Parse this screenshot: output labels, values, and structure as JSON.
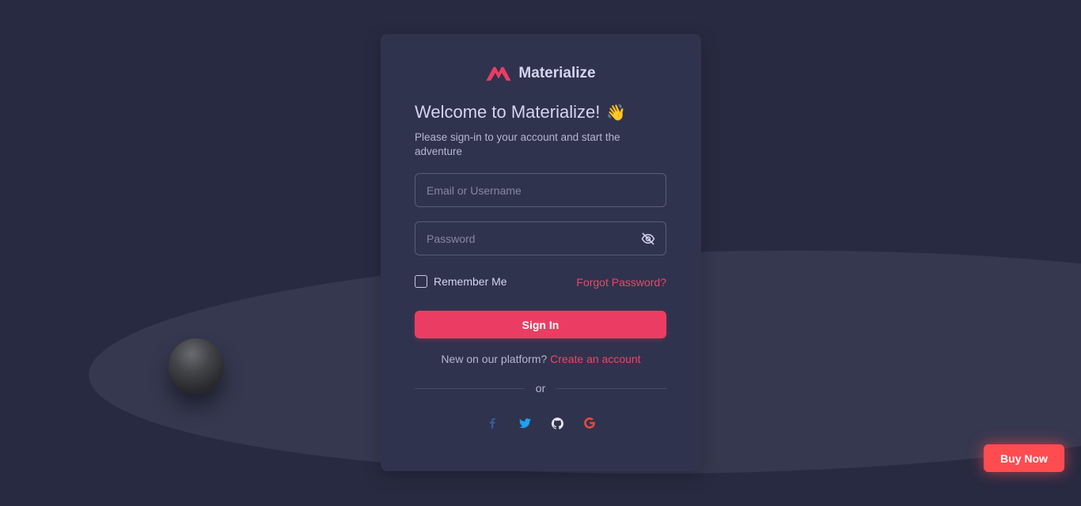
{
  "brand": {
    "name": "Materialize",
    "logo_icon": "materialize-logo-icon",
    "accent_color": "#eb3d63"
  },
  "login": {
    "heading": "Welcome to Materialize!",
    "heading_emoji": "👋",
    "subtext": "Please sign-in to your account and start the adventure",
    "email_placeholder": "Email or Username",
    "email_value": "",
    "password_placeholder": "Password",
    "password_value": "",
    "password_toggle_icon": "eye-off-icon",
    "remember_label": "Remember Me",
    "remember_checked": false,
    "forgot_label": "Forgot Password?",
    "signin_label": "Sign In",
    "new_prompt": "New on our platform?",
    "create_label": "Create an account",
    "divider_label": "or",
    "socials": [
      {
        "name": "facebook-icon",
        "color": "#3b5998"
      },
      {
        "name": "twitter-icon",
        "color": "#1da1f2"
      },
      {
        "name": "github-icon",
        "color": "#e7e7ee"
      },
      {
        "name": "google-icon",
        "color": "#dd4b39"
      }
    ]
  },
  "buy_now": {
    "label": "Buy Now",
    "color": "#ff4c51"
  }
}
